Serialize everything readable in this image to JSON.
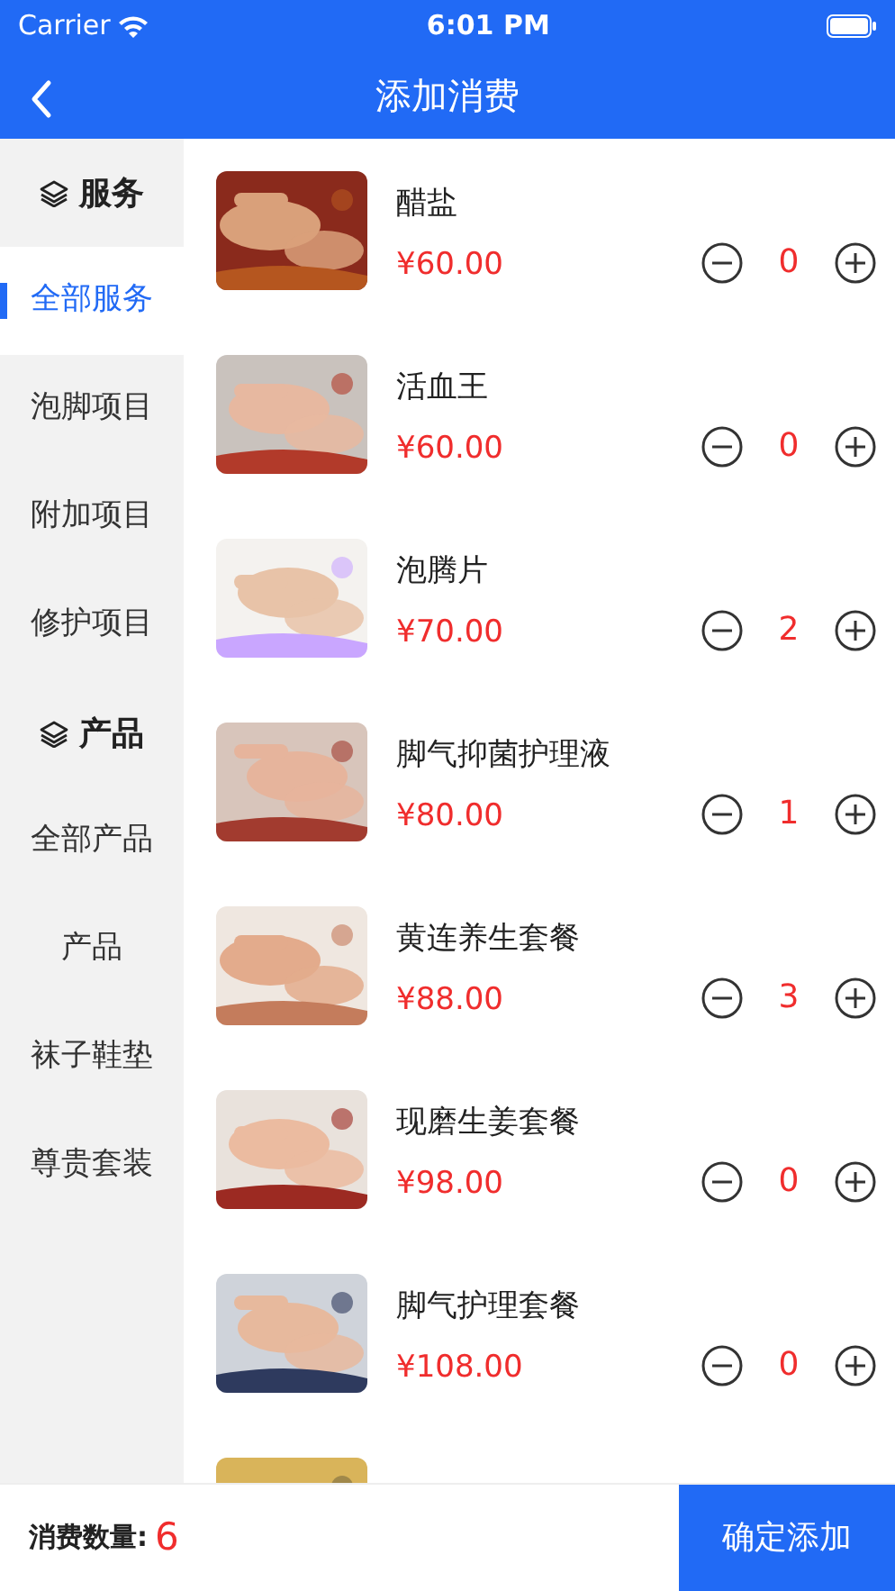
{
  "status_bar": {
    "carrier": "Carrier",
    "time": "6:01 PM"
  },
  "nav": {
    "title": "添加消费"
  },
  "sidebar": [
    {
      "kind": "header",
      "label": "服务"
    },
    {
      "kind": "item",
      "label": "全部服务",
      "selected": true
    },
    {
      "kind": "item",
      "label": "泡脚项目",
      "selected": false
    },
    {
      "kind": "item",
      "label": "附加项目",
      "selected": false
    },
    {
      "kind": "item",
      "label": "修护项目",
      "selected": false
    },
    {
      "kind": "header",
      "label": "产品"
    },
    {
      "kind": "item",
      "label": "全部产品",
      "selected": false
    },
    {
      "kind": "item",
      "label": "产品",
      "selected": false
    },
    {
      "kind": "item",
      "label": "袜子鞋垫",
      "selected": false
    },
    {
      "kind": "item",
      "label": "尊贵套装",
      "selected": false
    }
  ],
  "products": [
    {
      "kind": "product",
      "name": "醋盐",
      "price": "¥60.00",
      "quantity": "0"
    },
    {
      "kind": "product",
      "name": "活血王",
      "price": "¥60.00",
      "quantity": "0"
    },
    {
      "kind": "product",
      "name": "泡腾片",
      "price": "¥70.00",
      "quantity": "2"
    },
    {
      "kind": "product",
      "name": "脚气抑菌护理液",
      "price": "¥80.00",
      "quantity": "1"
    },
    {
      "kind": "product",
      "name": "黄连养生套餐",
      "price": "¥88.00",
      "quantity": "3"
    },
    {
      "kind": "product",
      "name": "现磨生姜套餐",
      "price": "¥98.00",
      "quantity": "0"
    },
    {
      "kind": "product",
      "name": "脚气护理套餐",
      "price": "¥108.00",
      "quantity": "0"
    },
    {
      "kind": "picture"
    }
  ],
  "footer": {
    "label": "消费数量:",
    "count": "6",
    "button": "确定添加"
  }
}
